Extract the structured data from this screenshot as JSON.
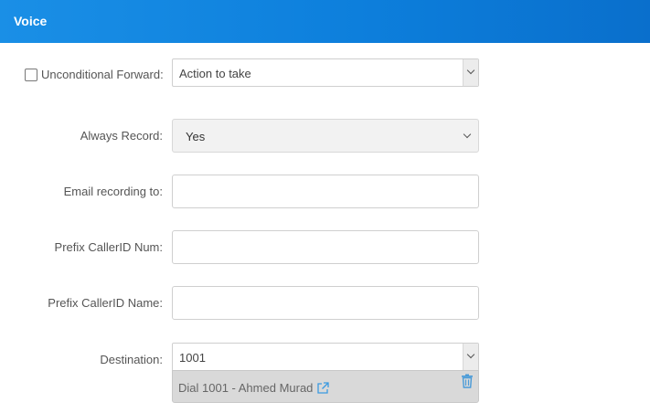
{
  "header": {
    "title": "Voice"
  },
  "form": {
    "unconditional_forward": {
      "label": "Unconditional Forward:",
      "checked": false,
      "select_value": "Action to take"
    },
    "always_record": {
      "label": "Always Record:",
      "value": "Yes"
    },
    "email_recording": {
      "label": "Email recording to:",
      "value": ""
    },
    "prefix_callerid_num": {
      "label": "Prefix CallerID Num:",
      "value": ""
    },
    "prefix_callerid_name": {
      "label": "Prefix CallerID Name:",
      "value": ""
    },
    "destination": {
      "label": "Destination:",
      "value": "1001",
      "selected_entry": "Dial 1001 - Ahmed Murad"
    }
  },
  "colors": {
    "header_start": "#1a8fe6",
    "header_end": "#0a6fcc",
    "link_icon": "#3b9ae1"
  },
  "icons": [
    "chevron-down-icon",
    "external-link-icon",
    "trash-icon",
    "checkbox-icon"
  ]
}
